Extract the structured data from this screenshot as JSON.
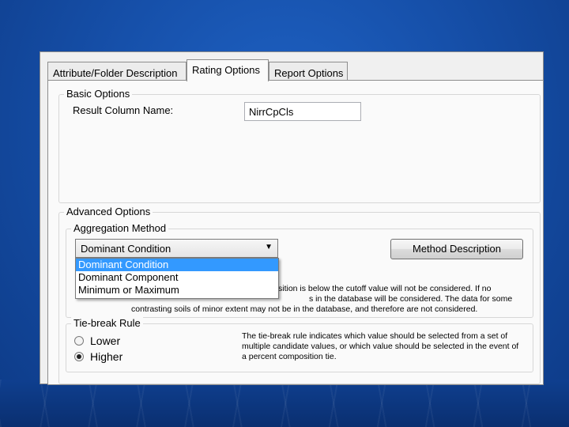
{
  "tabs": [
    {
      "label": "Attribute/Folder Description"
    },
    {
      "label": "Rating Options",
      "active": true
    },
    {
      "label": "Report Options"
    }
  ],
  "basic_options": {
    "title": "Basic Options",
    "result_column_label": "Result Column Name:",
    "result_column_value": "NirrCpCls"
  },
  "advanced_options": {
    "title": "Advanced Options",
    "aggregation": {
      "title": "Aggregation Method",
      "selected": "Dominant Condition",
      "options": [
        "Dominant Condition",
        "Dominant Component",
        "Minimum or Maximum"
      ],
      "method_button": "Method Description",
      "description_line1": "sition is below the cutoff value will not be considered.  If no",
      "description_line2": "s in the database will be considered.  The data for some",
      "description_line3": "contrasting soils of minor extent may not be in the database, and therefore are not considered."
    },
    "tie_break": {
      "title": "Tie-break Rule",
      "options": [
        {
          "label": "Lower",
          "checked": false
        },
        {
          "label": "Higher",
          "checked": true
        }
      ],
      "description": "The tie-break rule indicates which value should be selected from a set of multiple candidate values, or which value should be selected in the event of a percent composition tie."
    }
  }
}
